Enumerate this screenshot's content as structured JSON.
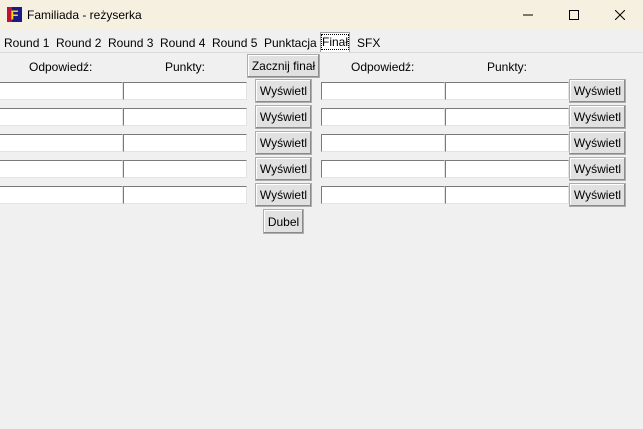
{
  "window": {
    "title": "Familiada - reżyserka",
    "icon": "familiada-app-icon",
    "minimize_icon": "minimize-icon",
    "maximize_icon": "maximize-icon",
    "close_icon": "close-icon"
  },
  "tabs": [
    {
      "label": "Round 1"
    },
    {
      "label": "Round 2"
    },
    {
      "label": "Round 3"
    },
    {
      "label": "Round 4"
    },
    {
      "label": "Round 5"
    },
    {
      "label": "Punktacja"
    },
    {
      "label": "Finał",
      "active": true
    },
    {
      "label": "SFX"
    }
  ],
  "final": {
    "left_answer_header": "Odpowiedź:",
    "left_points_header": "Punkty:",
    "right_answer_header": "Odpowiedź:",
    "right_points_header": "Punkty:",
    "start_button": "Zacznij finał",
    "show_button": "Wyświetl",
    "double_button": "Dubel",
    "left_rows": [
      {
        "answer": "",
        "points": ""
      },
      {
        "answer": "",
        "points": ""
      },
      {
        "answer": "",
        "points": ""
      },
      {
        "answer": "",
        "points": ""
      },
      {
        "answer": "",
        "points": ""
      }
    ],
    "right_rows": [
      {
        "answer": "",
        "points": ""
      },
      {
        "answer": "",
        "points": ""
      },
      {
        "answer": "",
        "points": ""
      },
      {
        "answer": "",
        "points": ""
      },
      {
        "answer": "",
        "points": ""
      }
    ]
  }
}
